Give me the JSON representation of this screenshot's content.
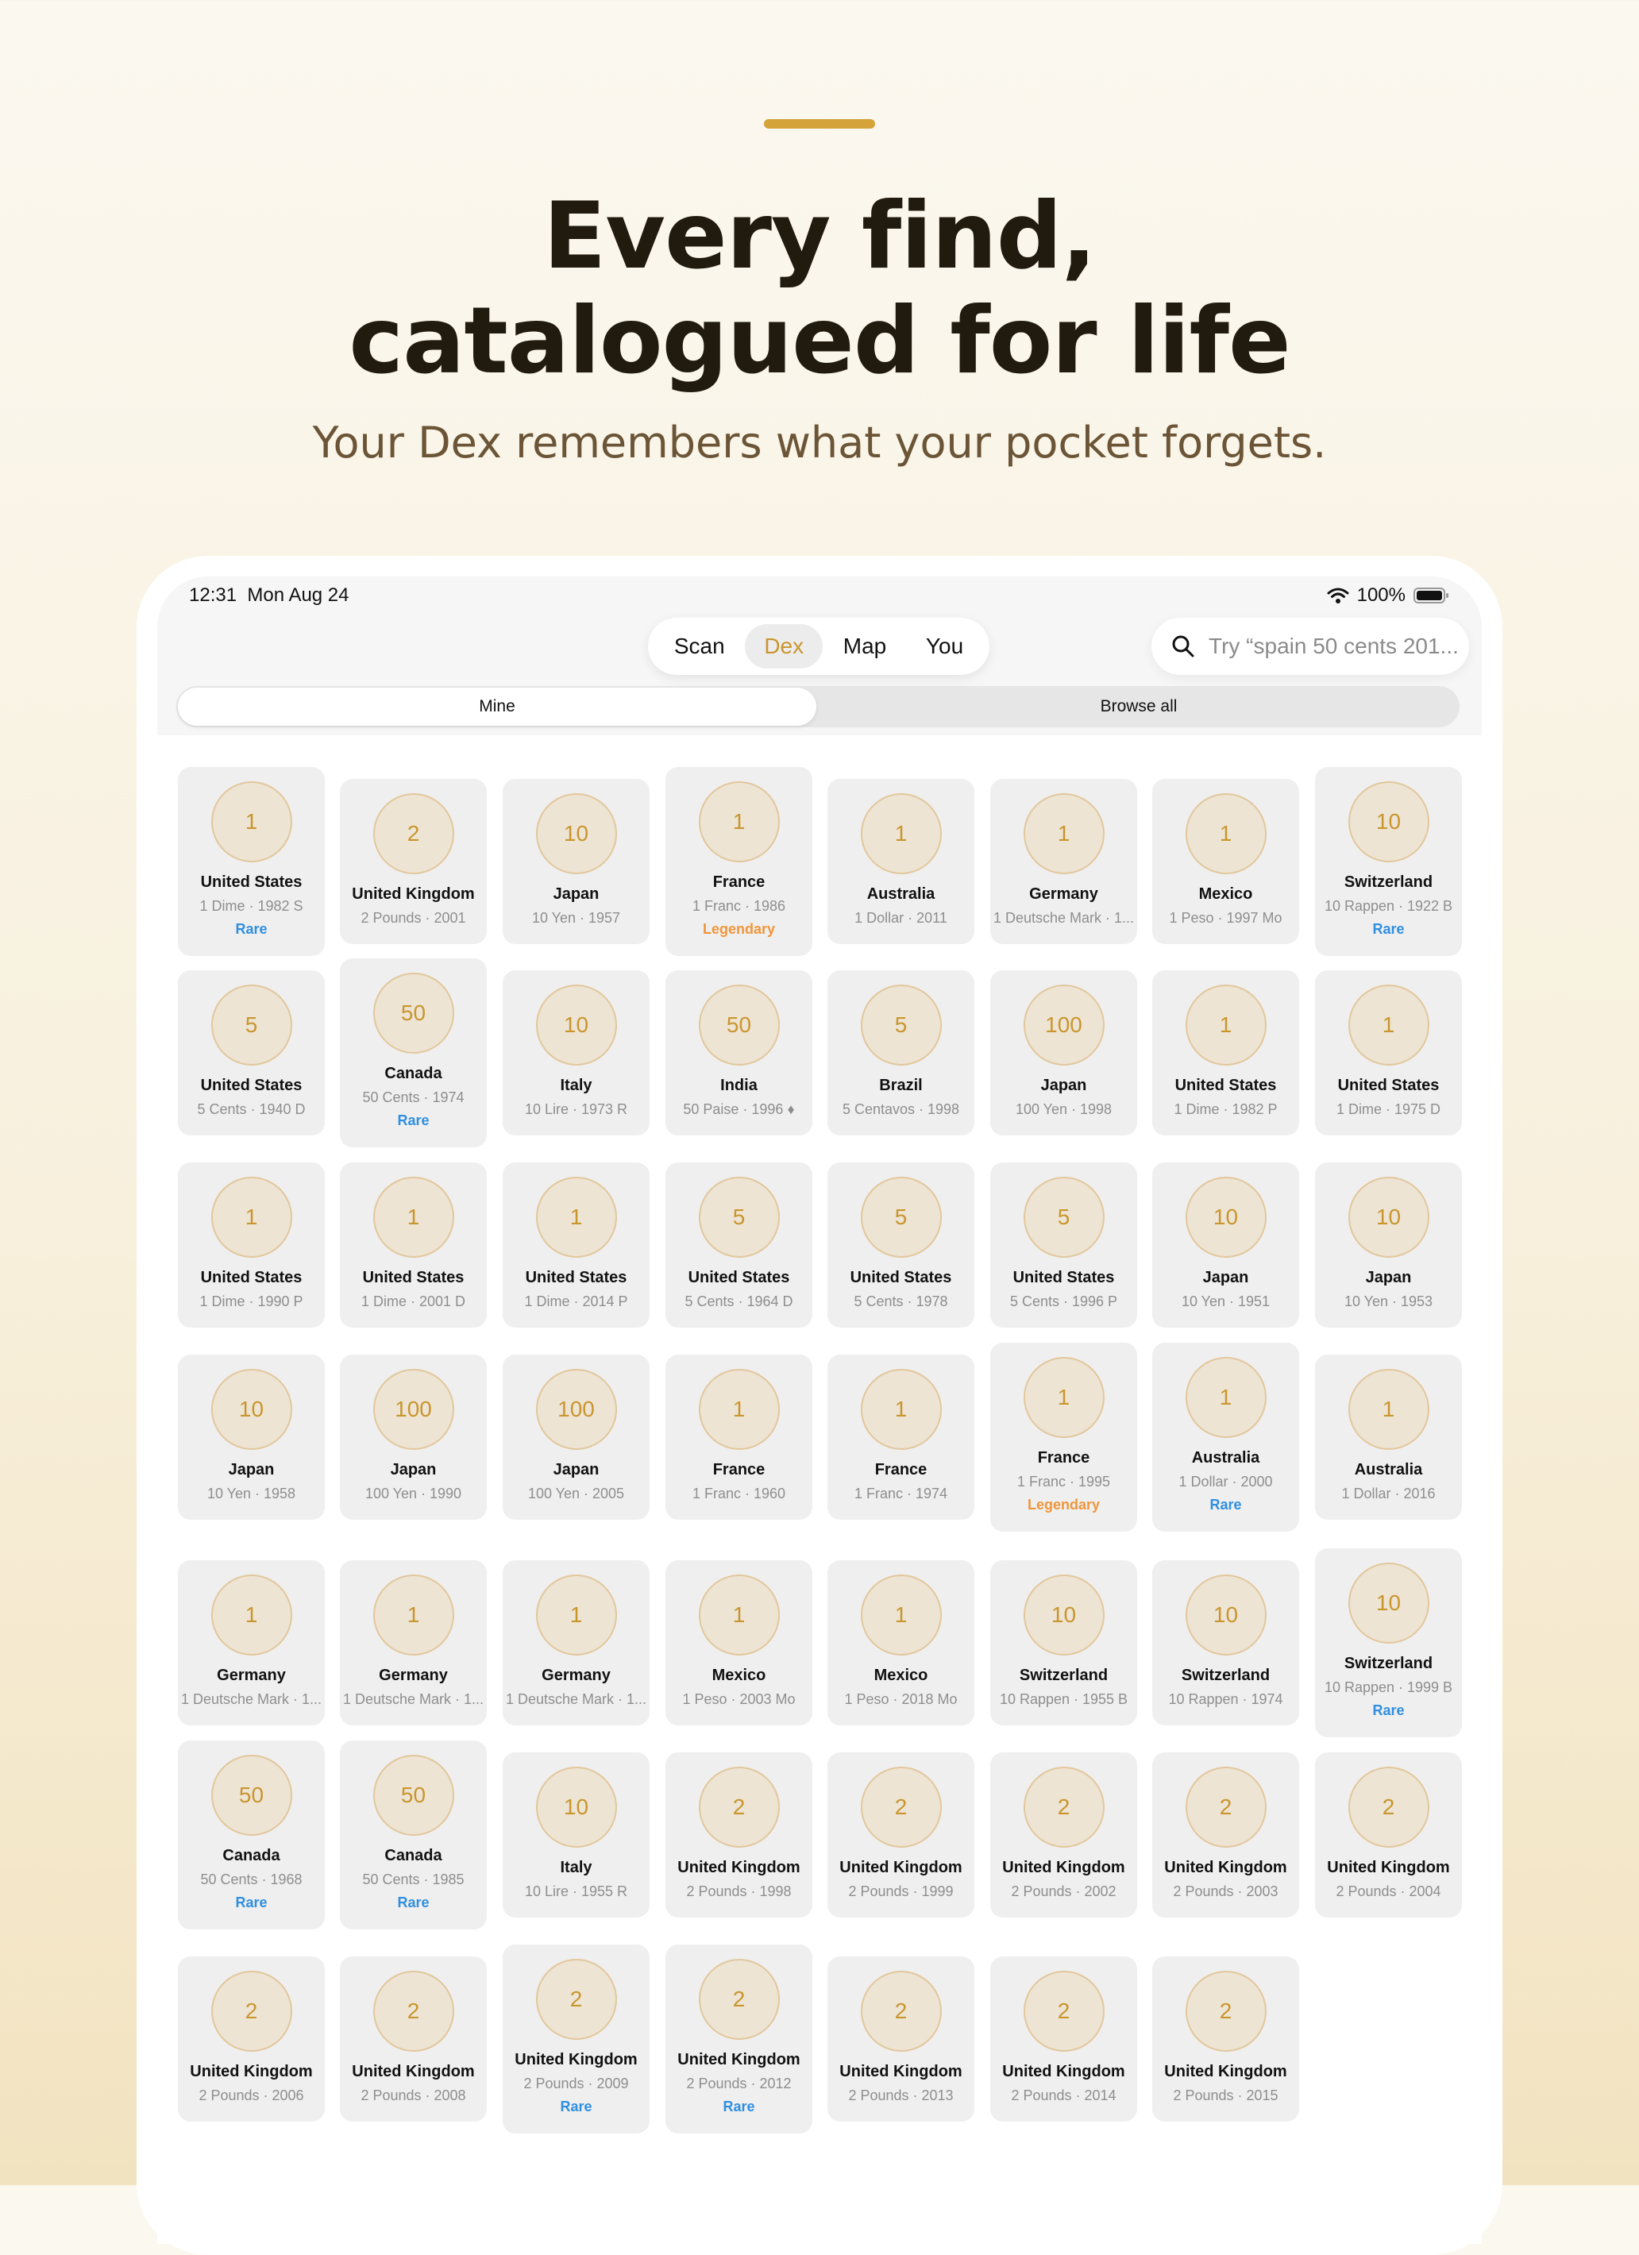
{
  "hero": {
    "title_line1": "Every find,",
    "title_line2": "catalogued for life",
    "subtitle": "Your Dex remembers what your pocket forgets."
  },
  "status_bar": {
    "time": "12:31",
    "date": "Mon Aug 24",
    "battery": "100%"
  },
  "tabs": [
    "Scan",
    "Dex",
    "Map",
    "You"
  ],
  "active_tab": "Dex",
  "search": {
    "placeholder": "Try “spain 50 cents 201..."
  },
  "segments": {
    "mine": "Mine",
    "browse_all": "Browse all",
    "selected": "Mine"
  },
  "colors": {
    "accent": "#d4a43b",
    "coin_fill": "#ede4d4",
    "coin_text": "#c9962e",
    "rare": "#2f8fe0",
    "legendary": "#f0963a",
    "card_bg": "#efefef"
  },
  "coins": [
    {
      "value": "1",
      "country": "United States",
      "detail": "1 Dime · 1982 S",
      "rarity": "Rare"
    },
    {
      "value": "2",
      "country": "United Kingdom",
      "detail": "2 Pounds · 2001",
      "rarity": ""
    },
    {
      "value": "10",
      "country": "Japan",
      "detail": "10 Yen · 1957",
      "rarity": ""
    },
    {
      "value": "1",
      "country": "France",
      "detail": "1 Franc · 1986",
      "rarity": "Legendary"
    },
    {
      "value": "1",
      "country": "Australia",
      "detail": "1 Dollar · 2011",
      "rarity": ""
    },
    {
      "value": "1",
      "country": "Germany",
      "detail": "1 Deutsche Mark · 1...",
      "rarity": ""
    },
    {
      "value": "1",
      "country": "Mexico",
      "detail": "1 Peso · 1997 Mo",
      "rarity": ""
    },
    {
      "value": "10",
      "country": "Switzerland",
      "detail": "10 Rappen · 1922 B",
      "rarity": "Rare"
    },
    {
      "value": "5",
      "country": "United States",
      "detail": "5 Cents · 1940 D",
      "rarity": ""
    },
    {
      "value": "50",
      "country": "Canada",
      "detail": "50 Cents · 1974",
      "rarity": "Rare"
    },
    {
      "value": "10",
      "country": "Italy",
      "detail": "10 Lire · 1973 R",
      "rarity": ""
    },
    {
      "value": "50",
      "country": "India",
      "detail": "50 Paise · 1996 ♦",
      "rarity": ""
    },
    {
      "value": "5",
      "country": "Brazil",
      "detail": "5 Centavos · 1998",
      "rarity": ""
    },
    {
      "value": "100",
      "country": "Japan",
      "detail": "100 Yen · 1998",
      "rarity": ""
    },
    {
      "value": "1",
      "country": "United States",
      "detail": "1 Dime · 1982 P",
      "rarity": ""
    },
    {
      "value": "1",
      "country": "United States",
      "detail": "1 Dime · 1975 D",
      "rarity": ""
    },
    {
      "value": "1",
      "country": "United States",
      "detail": "1 Dime · 1990 P",
      "rarity": ""
    },
    {
      "value": "1",
      "country": "United States",
      "detail": "1 Dime · 2001 D",
      "rarity": ""
    },
    {
      "value": "1",
      "country": "United States",
      "detail": "1 Dime · 2014 P",
      "rarity": ""
    },
    {
      "value": "5",
      "country": "United States",
      "detail": "5 Cents · 1964 D",
      "rarity": ""
    },
    {
      "value": "5",
      "country": "United States",
      "detail": "5 Cents · 1978",
      "rarity": ""
    },
    {
      "value": "5",
      "country": "United States",
      "detail": "5 Cents · 1996 P",
      "rarity": ""
    },
    {
      "value": "10",
      "country": "Japan",
      "detail": "10 Yen · 1951",
      "rarity": ""
    },
    {
      "value": "10",
      "country": "Japan",
      "detail": "10 Yen · 1953",
      "rarity": ""
    },
    {
      "value": "10",
      "country": "Japan",
      "detail": "10 Yen · 1958",
      "rarity": ""
    },
    {
      "value": "100",
      "country": "Japan",
      "detail": "100 Yen · 1990",
      "rarity": ""
    },
    {
      "value": "100",
      "country": "Japan",
      "detail": "100 Yen · 2005",
      "rarity": ""
    },
    {
      "value": "1",
      "country": "France",
      "detail": "1 Franc · 1960",
      "rarity": ""
    },
    {
      "value": "1",
      "country": "France",
      "detail": "1 Franc · 1974",
      "rarity": ""
    },
    {
      "value": "1",
      "country": "France",
      "detail": "1 Franc · 1995",
      "rarity": "Legendary"
    },
    {
      "value": "1",
      "country": "Australia",
      "detail": "1 Dollar · 2000",
      "rarity": "Rare"
    },
    {
      "value": "1",
      "country": "Australia",
      "detail": "1 Dollar · 2016",
      "rarity": ""
    },
    {
      "value": "1",
      "country": "Germany",
      "detail": "1 Deutsche Mark · 1...",
      "rarity": ""
    },
    {
      "value": "1",
      "country": "Germany",
      "detail": "1 Deutsche Mark · 1...",
      "rarity": ""
    },
    {
      "value": "1",
      "country": "Germany",
      "detail": "1 Deutsche Mark · 1...",
      "rarity": ""
    },
    {
      "value": "1",
      "country": "Mexico",
      "detail": "1 Peso · 2003 Mo",
      "rarity": ""
    },
    {
      "value": "1",
      "country": "Mexico",
      "detail": "1 Peso · 2018 Mo",
      "rarity": ""
    },
    {
      "value": "10",
      "country": "Switzerland",
      "detail": "10 Rappen · 1955 B",
      "rarity": ""
    },
    {
      "value": "10",
      "country": "Switzerland",
      "detail": "10 Rappen · 1974",
      "rarity": ""
    },
    {
      "value": "10",
      "country": "Switzerland",
      "detail": "10 Rappen · 1999 B",
      "rarity": "Rare"
    },
    {
      "value": "50",
      "country": "Canada",
      "detail": "50 Cents · 1968",
      "rarity": "Rare"
    },
    {
      "value": "50",
      "country": "Canada",
      "detail": "50 Cents · 1985",
      "rarity": "Rare"
    },
    {
      "value": "10",
      "country": "Italy",
      "detail": "10 Lire · 1955 R",
      "rarity": ""
    },
    {
      "value": "2",
      "country": "United Kingdom",
      "detail": "2 Pounds · 1998",
      "rarity": ""
    },
    {
      "value": "2",
      "country": "United Kingdom",
      "detail": "2 Pounds · 1999",
      "rarity": ""
    },
    {
      "value": "2",
      "country": "United Kingdom",
      "detail": "2 Pounds · 2002",
      "rarity": ""
    },
    {
      "value": "2",
      "country": "United Kingdom",
      "detail": "2 Pounds · 2003",
      "rarity": ""
    },
    {
      "value": "2",
      "country": "United Kingdom",
      "detail": "2 Pounds · 2004",
      "rarity": ""
    },
    {
      "value": "2",
      "country": "United Kingdom",
      "detail": "2 Pounds · 2006",
      "rarity": ""
    },
    {
      "value": "2",
      "country": "United Kingdom",
      "detail": "2 Pounds · 2008",
      "rarity": ""
    },
    {
      "value": "2",
      "country": "United Kingdom",
      "detail": "2 Pounds · 2009",
      "rarity": "Rare"
    },
    {
      "value": "2",
      "country": "United Kingdom",
      "detail": "2 Pounds · 2012",
      "rarity": "Rare"
    },
    {
      "value": "2",
      "country": "United Kingdom",
      "detail": "2 Pounds · 2013",
      "rarity": ""
    },
    {
      "value": "2",
      "country": "United Kingdom",
      "detail": "2 Pounds · 2014",
      "rarity": ""
    },
    {
      "value": "2",
      "country": "United Kingdom",
      "detail": "2 Pounds · 2015",
      "rarity": ""
    }
  ]
}
